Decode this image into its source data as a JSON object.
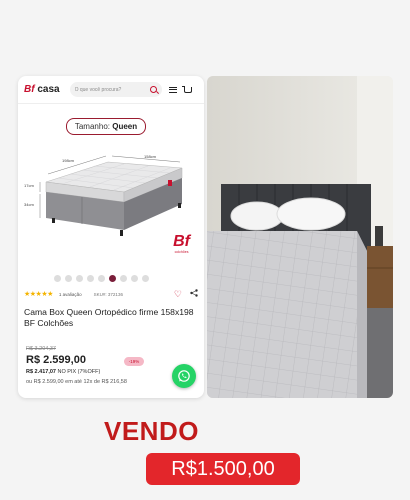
{
  "header": {
    "logo_bf": "Bf",
    "logo_casa": "casa",
    "search_placeholder": "O que você procura?"
  },
  "product_image": {
    "size_label_prefix": "Tamanho:",
    "size_label_value": "Queen",
    "dimensions": {
      "length": "198cm",
      "width": "158cm",
      "mattress_height": "17cm",
      "box_height": "34cm"
    },
    "brand_mark": "Bf",
    "brand_sub": "colchões"
  },
  "gallery": {
    "total": 9,
    "active_index": 5
  },
  "rating": {
    "stars": "★★★★★",
    "count_label": "1 avaliação",
    "sku": "SKU#: 372136"
  },
  "product": {
    "title": "Cama Box Queen Ortopédico firme 158x198 BF Colchões",
    "old_price": "R$ 3.204,37",
    "price": "R$ 2.599,00",
    "discount_badge": "-19%",
    "pix_price": "R$ 2.417,07",
    "pix_label": "NO PIX (7%OFF)",
    "installments": "ou R$ 2.599,00 em até 12x de R$ 216,58"
  },
  "sale": {
    "headline": "VENDO",
    "price": "R$1.500,00"
  },
  "colors": {
    "brand_red": "#c8102e",
    "headline_red": "#c11b1b",
    "badge_red": "#e3262b",
    "whatsapp_green": "#25d366",
    "gallery_active": "#7a1e3a"
  }
}
